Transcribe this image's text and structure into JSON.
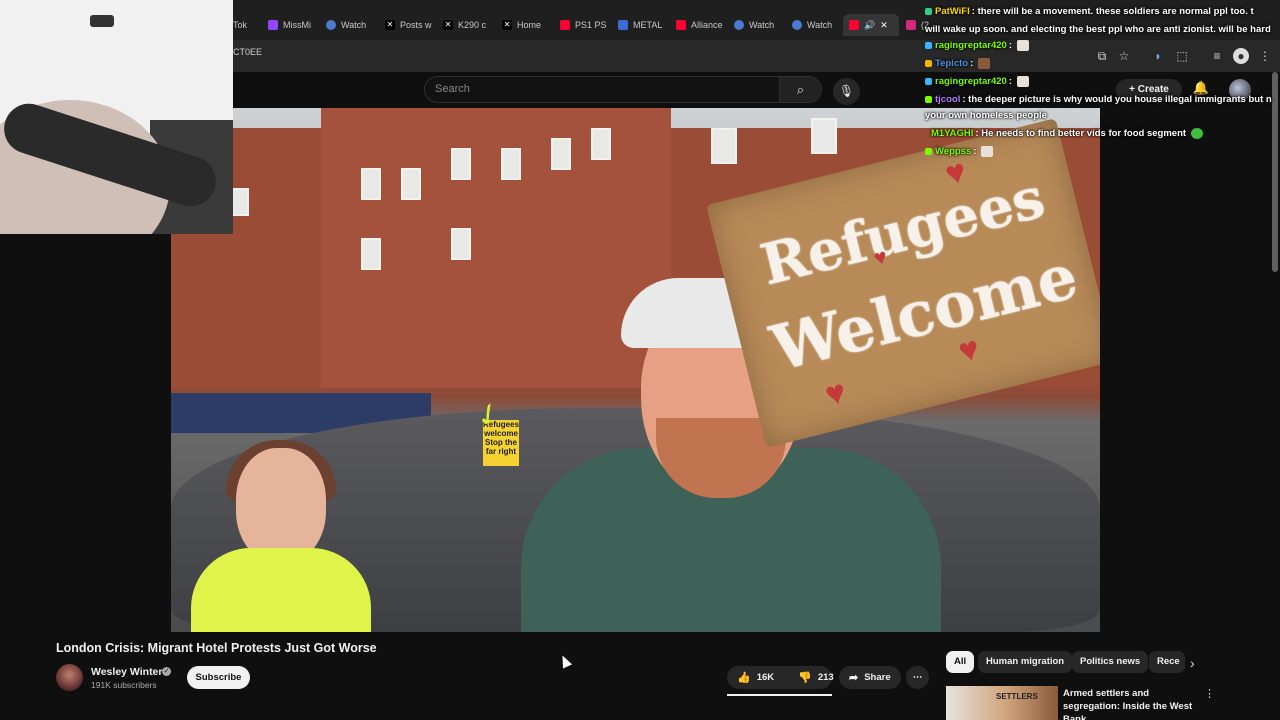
{
  "browser": {
    "tabs": [
      {
        "label": "Tok",
        "favicon": "tiktok-icon",
        "color": "#222"
      },
      {
        "label": "MissMi",
        "favicon": "twitch-icon",
        "color": "#9146ff"
      },
      {
        "label": "Watch",
        "favicon": "globe-icon",
        "color": "#4a7bd0"
      },
      {
        "label": "Posts w",
        "favicon": "x-icon",
        "color": "#000"
      },
      {
        "label": "K290 c",
        "favicon": "x-icon",
        "color": "#000"
      },
      {
        "label": "Home",
        "favicon": "x-icon",
        "color": "#000"
      },
      {
        "label": "PS1 PS",
        "favicon": "youtube-icon",
        "color": "#ff0033"
      },
      {
        "label": "METAL",
        "favicon": "site-icon",
        "color": "#3a6bd6"
      },
      {
        "label": "Alliance",
        "favicon": "youtube-icon",
        "color": "#ff0033"
      },
      {
        "label": "Watch",
        "favicon": "globe-icon",
        "color": "#4a7bd0"
      },
      {
        "label": "Watch",
        "favicon": "globe-icon",
        "color": "#4a7bd0"
      }
    ],
    "active_tab_label": "",
    "next_tab_label": "(2",
    "url_fragment": "CT0EE"
  },
  "youtube": {
    "search_placeholder": "Search",
    "create_label": "Create",
    "video_title": "London Crisis: Migrant Hotel Protests Just Got Worse",
    "channel_name": "Wesley Winter",
    "subscribers": "191K subscribers",
    "subscribe_label": "Subscribe",
    "like_count": "16K",
    "dislike_count": "213",
    "share_label": "Share",
    "chips": [
      "All",
      "Human migration",
      "Politics news",
      "Rece"
    ],
    "rec_title": "Armed settlers and segregation: Inside the West Bank",
    "rec_thumb_text": "SETTLERS"
  },
  "video_frame": {
    "sign_line1": "Refugees",
    "sign_line2": "Welcome",
    "placard_text": "Refugees welcome Stop the far right"
  },
  "chat": [
    {
      "user": "PatWiFI",
      "text": "there will be a movement. these soldiers are normal ppl too. t",
      "color": "#ffd700"
    },
    {
      "user": "",
      "text": "will wake up soon. and electing the best ppl who are anti zionist. will be hard",
      "color": "#ffffff"
    },
    {
      "user": "ragingreptar420",
      "text": "",
      "color": "#7cfc00",
      "emote": true
    },
    {
      "user": "Tepicto",
      "text": "",
      "color": "#4a90e2",
      "emote": true
    },
    {
      "user": "ragingreptar420",
      "text": "",
      "color": "#7cfc00",
      "emote": true
    },
    {
      "user": "tjcool",
      "text": "the deeper picture is why would you house illegal immigrants but n",
      "color": "#b57bff"
    },
    {
      "user": "",
      "text": "your own homeless people",
      "color": "#ffffff"
    },
    {
      "user": "M1YAGHI",
      "text": "He needs to find better vids for food segment",
      "color": "#7cfc00",
      "emote": true
    },
    {
      "user": "Weppss",
      "text": "",
      "color": "#7cfc00",
      "emote": true
    }
  ]
}
